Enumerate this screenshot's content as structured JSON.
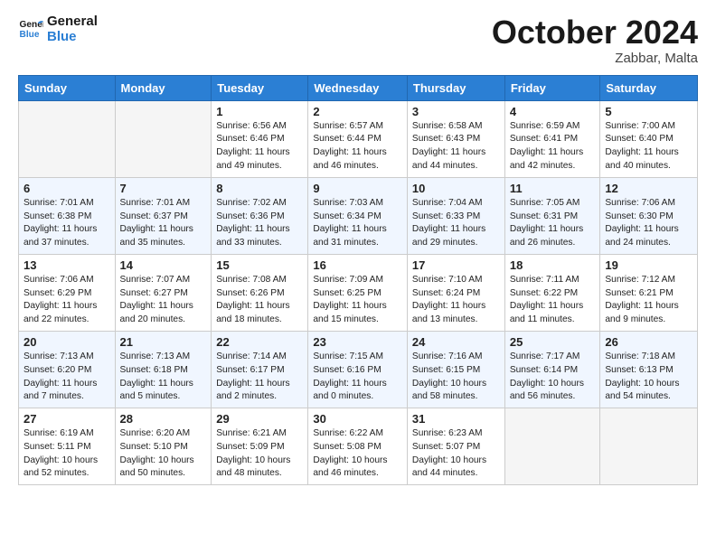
{
  "logo": {
    "line1": "General",
    "line2": "Blue"
  },
  "title": "October 2024",
  "subtitle": "Zabbar, Malta",
  "days_of_week": [
    "Sunday",
    "Monday",
    "Tuesday",
    "Wednesday",
    "Thursday",
    "Friday",
    "Saturday"
  ],
  "weeks": [
    [
      {
        "day": "",
        "info": ""
      },
      {
        "day": "",
        "info": ""
      },
      {
        "day": "1",
        "info": "Sunrise: 6:56 AM\nSunset: 6:46 PM\nDaylight: 11 hours and 49 minutes."
      },
      {
        "day": "2",
        "info": "Sunrise: 6:57 AM\nSunset: 6:44 PM\nDaylight: 11 hours and 46 minutes."
      },
      {
        "day": "3",
        "info": "Sunrise: 6:58 AM\nSunset: 6:43 PM\nDaylight: 11 hours and 44 minutes."
      },
      {
        "day": "4",
        "info": "Sunrise: 6:59 AM\nSunset: 6:41 PM\nDaylight: 11 hours and 42 minutes."
      },
      {
        "day": "5",
        "info": "Sunrise: 7:00 AM\nSunset: 6:40 PM\nDaylight: 11 hours and 40 minutes."
      }
    ],
    [
      {
        "day": "6",
        "info": "Sunrise: 7:01 AM\nSunset: 6:38 PM\nDaylight: 11 hours and 37 minutes."
      },
      {
        "day": "7",
        "info": "Sunrise: 7:01 AM\nSunset: 6:37 PM\nDaylight: 11 hours and 35 minutes."
      },
      {
        "day": "8",
        "info": "Sunrise: 7:02 AM\nSunset: 6:36 PM\nDaylight: 11 hours and 33 minutes."
      },
      {
        "day": "9",
        "info": "Sunrise: 7:03 AM\nSunset: 6:34 PM\nDaylight: 11 hours and 31 minutes."
      },
      {
        "day": "10",
        "info": "Sunrise: 7:04 AM\nSunset: 6:33 PM\nDaylight: 11 hours and 29 minutes."
      },
      {
        "day": "11",
        "info": "Sunrise: 7:05 AM\nSunset: 6:31 PM\nDaylight: 11 hours and 26 minutes."
      },
      {
        "day": "12",
        "info": "Sunrise: 7:06 AM\nSunset: 6:30 PM\nDaylight: 11 hours and 24 minutes."
      }
    ],
    [
      {
        "day": "13",
        "info": "Sunrise: 7:06 AM\nSunset: 6:29 PM\nDaylight: 11 hours and 22 minutes."
      },
      {
        "day": "14",
        "info": "Sunrise: 7:07 AM\nSunset: 6:27 PM\nDaylight: 11 hours and 20 minutes."
      },
      {
        "day": "15",
        "info": "Sunrise: 7:08 AM\nSunset: 6:26 PM\nDaylight: 11 hours and 18 minutes."
      },
      {
        "day": "16",
        "info": "Sunrise: 7:09 AM\nSunset: 6:25 PM\nDaylight: 11 hours and 15 minutes."
      },
      {
        "day": "17",
        "info": "Sunrise: 7:10 AM\nSunset: 6:24 PM\nDaylight: 11 hours and 13 minutes."
      },
      {
        "day": "18",
        "info": "Sunrise: 7:11 AM\nSunset: 6:22 PM\nDaylight: 11 hours and 11 minutes."
      },
      {
        "day": "19",
        "info": "Sunrise: 7:12 AM\nSunset: 6:21 PM\nDaylight: 11 hours and 9 minutes."
      }
    ],
    [
      {
        "day": "20",
        "info": "Sunrise: 7:13 AM\nSunset: 6:20 PM\nDaylight: 11 hours and 7 minutes."
      },
      {
        "day": "21",
        "info": "Sunrise: 7:13 AM\nSunset: 6:18 PM\nDaylight: 11 hours and 5 minutes."
      },
      {
        "day": "22",
        "info": "Sunrise: 7:14 AM\nSunset: 6:17 PM\nDaylight: 11 hours and 2 minutes."
      },
      {
        "day": "23",
        "info": "Sunrise: 7:15 AM\nSunset: 6:16 PM\nDaylight: 11 hours and 0 minutes."
      },
      {
        "day": "24",
        "info": "Sunrise: 7:16 AM\nSunset: 6:15 PM\nDaylight: 10 hours and 58 minutes."
      },
      {
        "day": "25",
        "info": "Sunrise: 7:17 AM\nSunset: 6:14 PM\nDaylight: 10 hours and 56 minutes."
      },
      {
        "day": "26",
        "info": "Sunrise: 7:18 AM\nSunset: 6:13 PM\nDaylight: 10 hours and 54 minutes."
      }
    ],
    [
      {
        "day": "27",
        "info": "Sunrise: 6:19 AM\nSunset: 5:11 PM\nDaylight: 10 hours and 52 minutes."
      },
      {
        "day": "28",
        "info": "Sunrise: 6:20 AM\nSunset: 5:10 PM\nDaylight: 10 hours and 50 minutes."
      },
      {
        "day": "29",
        "info": "Sunrise: 6:21 AM\nSunset: 5:09 PM\nDaylight: 10 hours and 48 minutes."
      },
      {
        "day": "30",
        "info": "Sunrise: 6:22 AM\nSunset: 5:08 PM\nDaylight: 10 hours and 46 minutes."
      },
      {
        "day": "31",
        "info": "Sunrise: 6:23 AM\nSunset: 5:07 PM\nDaylight: 10 hours and 44 minutes."
      },
      {
        "day": "",
        "info": ""
      },
      {
        "day": "",
        "info": ""
      }
    ]
  ]
}
